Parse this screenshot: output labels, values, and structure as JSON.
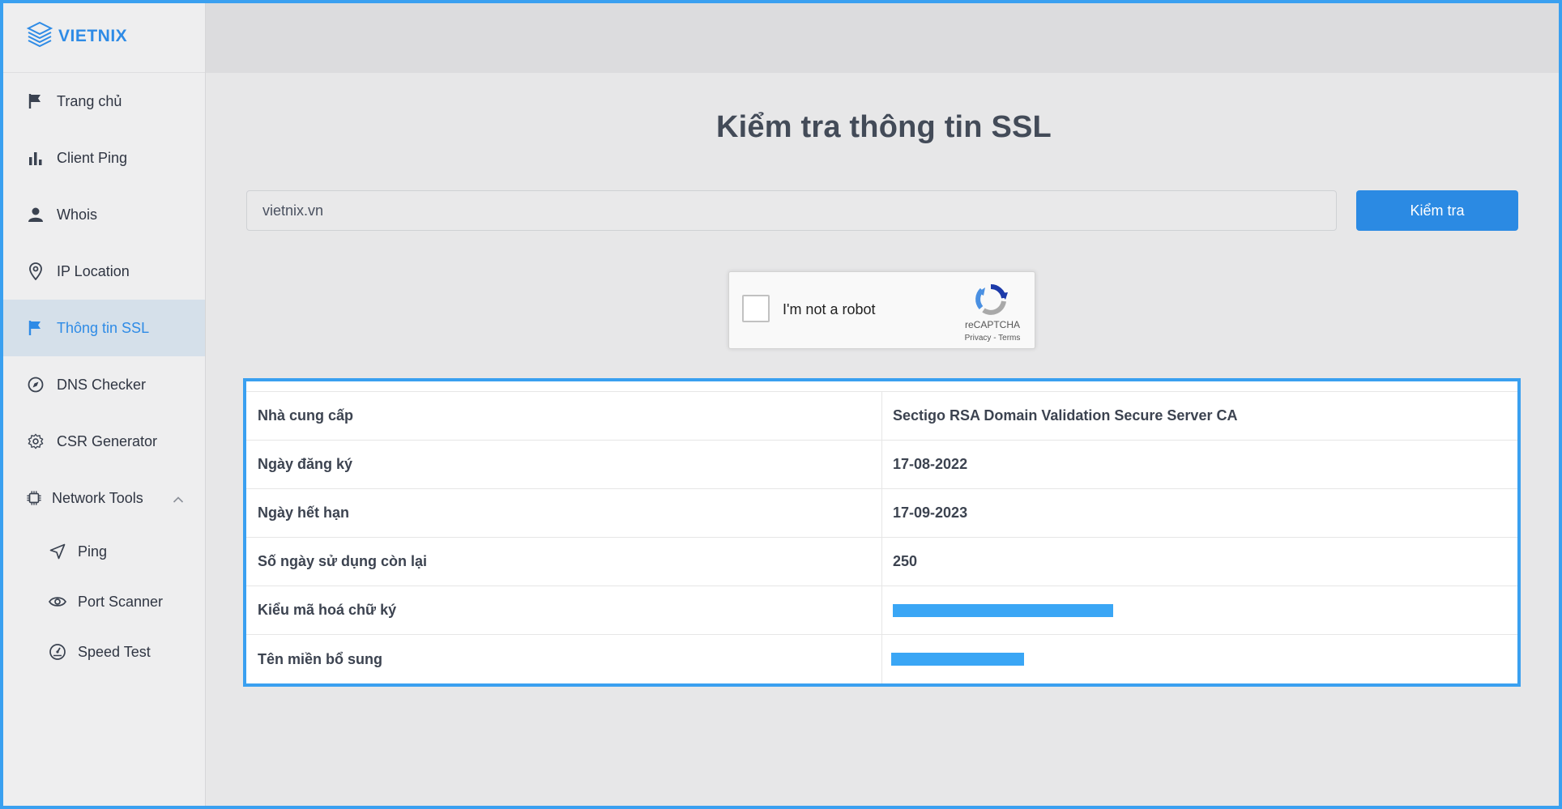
{
  "brand": {
    "logo_text": "VIETNIX",
    "accent": "#2e8be6"
  },
  "sidebar": {
    "items": [
      {
        "label": "Trang chủ",
        "icon": "flag-icon"
      },
      {
        "label": "Client Ping",
        "icon": "bar-chart-icon"
      },
      {
        "label": "Whois",
        "icon": "user-icon"
      },
      {
        "label": "IP Location",
        "icon": "location-pin-icon"
      },
      {
        "label": "Thông tin SSL",
        "icon": "flag-icon",
        "active": true
      },
      {
        "label": "DNS Checker",
        "icon": "compass-icon"
      },
      {
        "label": "CSR Generator",
        "icon": "gear-icon"
      }
    ],
    "group": {
      "label": "Network Tools",
      "icon": "chip-icon",
      "expanded": true,
      "children": [
        {
          "label": "Ping",
          "icon": "send-icon"
        },
        {
          "label": "Port Scanner",
          "icon": "eye-icon"
        },
        {
          "label": "Speed Test",
          "icon": "speedometer-icon"
        }
      ]
    }
  },
  "main": {
    "title": "Kiểm tra thông tin SSL",
    "search": {
      "value": "vietnix.vn",
      "button_label": "Kiểm tra"
    },
    "recaptcha": {
      "label": "I'm not a robot",
      "brand": "reCAPTCHA",
      "links": "Privacy - Terms"
    },
    "results": [
      {
        "key": "Nhà cung cấp",
        "value": "Sectigo RSA Domain Validation Secure Server CA"
      },
      {
        "key": "Ngày đăng ký",
        "value": "17-08-2022"
      },
      {
        "key": "Ngày hết hạn",
        "value": "17-09-2023"
      },
      {
        "key": "Số ngày sử dụng còn lại",
        "value": "250"
      },
      {
        "key": "Kiểu mã hoá chữ ký",
        "value": null,
        "redacted": true
      },
      {
        "key": "Tên miền bổ sung",
        "value": null,
        "redacted": true
      }
    ]
  }
}
